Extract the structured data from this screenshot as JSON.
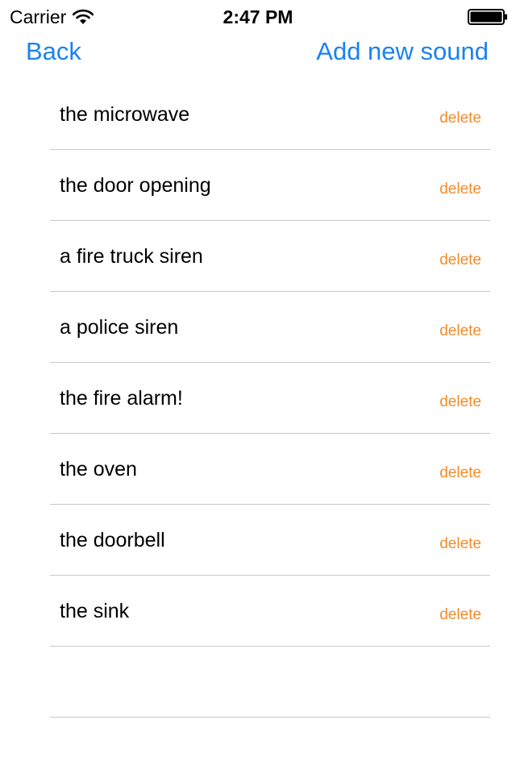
{
  "status_bar": {
    "carrier": "Carrier",
    "time": "2:47 PM",
    "icons": [
      "wifi-icon",
      "battery-icon"
    ]
  },
  "nav": {
    "back_label": "Back",
    "add_label": "Add new sound",
    "tint_color": "#1a82f0"
  },
  "sounds": [
    {
      "name": "the microwave",
      "action": "delete"
    },
    {
      "name": "the door opening",
      "action": "delete"
    },
    {
      "name": "a fire truck siren",
      "action": "delete"
    },
    {
      "name": "a police siren",
      "action": "delete"
    },
    {
      "name": "the fire alarm!",
      "action": "delete"
    },
    {
      "name": "the oven",
      "action": "delete"
    },
    {
      "name": "the doorbell",
      "action": "delete"
    },
    {
      "name": "the sink",
      "action": "delete"
    }
  ],
  "colors": {
    "delete": "#f08c2a",
    "separator": "#c8c7cc"
  }
}
